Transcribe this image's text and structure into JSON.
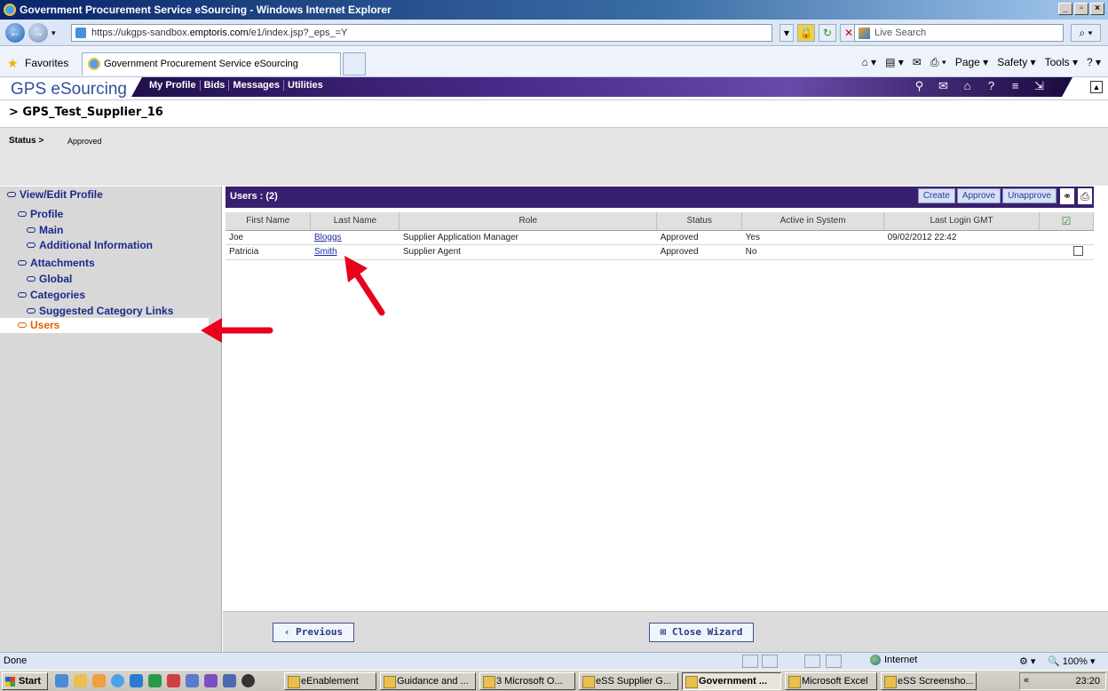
{
  "browser": {
    "window_title": "Government Procurement Service eSourcing - Windows Internet Explorer",
    "url_prefix": "https://ukgps-sandbox.",
    "url_domain": "emptoris.com",
    "url_path": "/e1/index.jsp?_eps_=Y",
    "search_placeholder": "Live Search",
    "favorites_label": "Favorites",
    "tab_title": "Government Procurement Service eSourcing",
    "command_bar": [
      "Page ▾",
      "Safety ▾",
      "Tools ▾"
    ],
    "status_text": "Done",
    "zone": "Internet",
    "zoom": "100%"
  },
  "app": {
    "brand": "GPS eSourcing",
    "menu": [
      "My Profile",
      "Bids",
      "Messages",
      "Utilities"
    ],
    "supplier": "> GPS_Test_Supplier_16",
    "status_label": "Status >",
    "status_value": "Approved"
  },
  "sidebar": {
    "items": [
      {
        "label": "View/Edit Profile"
      },
      {
        "label": "Profile"
      },
      {
        "label": "Main"
      },
      {
        "label": "Additional Information"
      },
      {
        "label": "Attachments"
      },
      {
        "label": "Global"
      },
      {
        "label": "Categories"
      },
      {
        "label": "Suggested Category Links"
      },
      {
        "label": "Users"
      }
    ]
  },
  "grid": {
    "title": "Users : (2)",
    "buttons": [
      "Create",
      "Approve",
      "Unapprove"
    ],
    "columns": [
      "First Name",
      "Last Name",
      "Role",
      "Status",
      "Active in System",
      "Last Login GMT"
    ],
    "rows": [
      {
        "first": "Joe",
        "last": "Bloggs",
        "role": "Supplier Application Manager",
        "status": "Approved",
        "active": "Yes",
        "login": "09/02/2012 22:42"
      },
      {
        "first": "Patricia",
        "last": "Smith",
        "role": "Supplier Agent",
        "status": "Approved",
        "active": "No",
        "login": ""
      }
    ]
  },
  "footer": {
    "previous": "‹ Previous",
    "close": "⊠ Close Wizard"
  },
  "taskbar": {
    "start": "Start",
    "tasks": [
      "eEnablement",
      "Guidance and ...",
      "3 Microsoft O...",
      "eSS Supplier G...",
      "Government ...",
      "Microsoft Excel",
      "eSS Screensho..."
    ],
    "clock": "23:20"
  },
  "colors": {
    "menubar": "#382070",
    "active_nav": "#e06000",
    "annotation_arrow": "#e8001c"
  }
}
